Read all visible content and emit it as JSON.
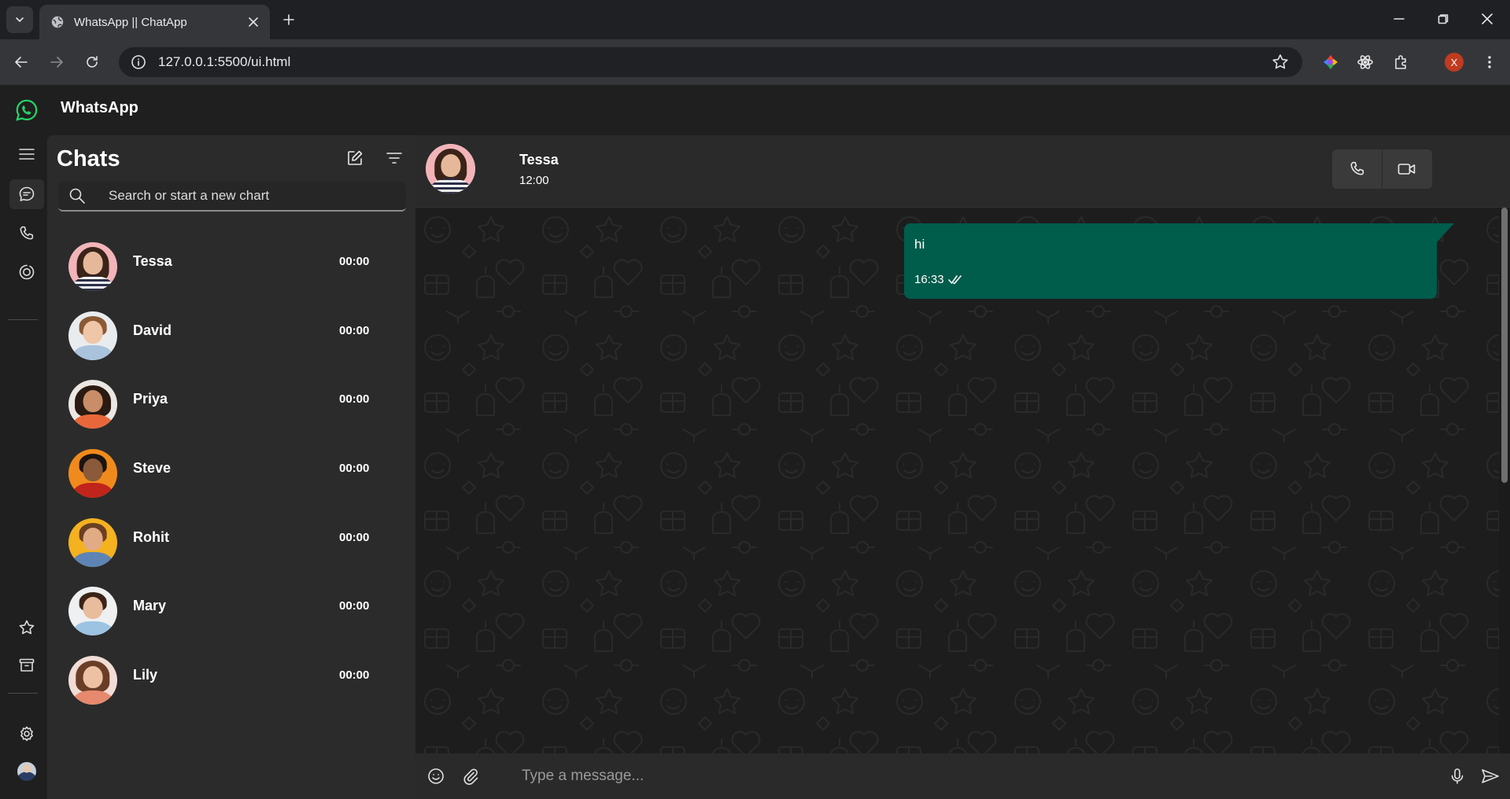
{
  "browser": {
    "tab_title": "WhatsApp || ChatApp",
    "url": "127.0.0.1:5500/ui.html",
    "profile_initial": "X"
  },
  "app": {
    "title": "WhatsApp",
    "brand_color": "#25D366"
  },
  "sidebar": {
    "heading": "Chats",
    "search_placeholder": "Search or start a new chart",
    "chats": [
      {
        "name": "Tessa",
        "time": "00:00"
      },
      {
        "name": "David",
        "time": "00:00"
      },
      {
        "name": "Priya",
        "time": "00:00"
      },
      {
        "name": "Steve",
        "time": "00:00"
      },
      {
        "name": "Rohit",
        "time": "00:00"
      },
      {
        "name": "Mary",
        "time": "00:00"
      },
      {
        "name": "Lily",
        "time": "00:00"
      }
    ]
  },
  "chat": {
    "contact_name": "Tessa",
    "contact_status": "12:00",
    "messages": [
      {
        "text": "hi",
        "time": "16:33",
        "ticks": "double-check-icon"
      }
    ],
    "outgoing_bubble_color": "#005C4B",
    "composer_placeholder": "Type a message..."
  }
}
